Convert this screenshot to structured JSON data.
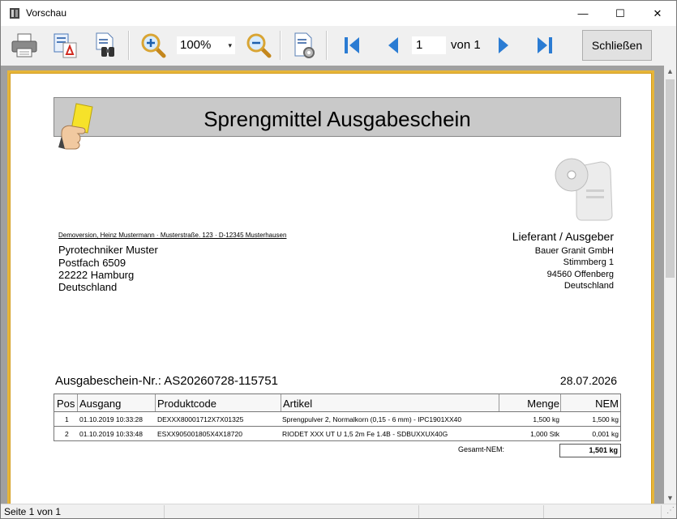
{
  "window": {
    "title": "Vorschau",
    "minimize_glyph": "—",
    "maximize_glyph": "☐",
    "close_glyph": "✕"
  },
  "toolbar": {
    "zoom_value": "100%",
    "page_value": "1",
    "page_of": "von 1",
    "close_label": "Schließen"
  },
  "document": {
    "title": "Sprengmittel Ausgabeschein",
    "sender_line": "Demoversion, Heinz Mustermann · Musterstraße. 123 · D-12345 Musterhausen",
    "recipient": {
      "line1": "Pyrotechniker Muster",
      "line2": "Postfach 6509",
      "line3": "22222 Hamburg",
      "line4": "Deutschland"
    },
    "supplier": {
      "heading": "Lieferant / Ausgeber",
      "line1": "Bauer Granit GmbH",
      "line2": "Stimmberg 1",
      "line3": "94560 Offenberg",
      "line4": "Deutschland"
    },
    "doc_number": "Ausgabeschein-Nr.: AS20260728-115751",
    "doc_date": "28.07.2026",
    "table": {
      "headers": [
        "Pos",
        "Ausgang",
        "Produktcode",
        "Artikel",
        "Menge",
        "NEM"
      ],
      "rows": [
        [
          "1",
          "01.10.2019 10:33:28",
          "DEXXX80001712X7X01325",
          "Sprengpulver 2, Normalkorn (0,15 - 6 mm) - IPC1901XX40",
          "1,500 kg",
          "1,500 kg"
        ],
        [
          "2",
          "01.10.2019 10:33:48",
          "ESXX905001805X4X18720",
          "RIODET XXX UT U 1,5 2m Fe 1.4B - SDBUXXUX40G",
          "1,000 Stk",
          "0,001 kg"
        ]
      ]
    },
    "total_label": "Gesamt-NEM:",
    "total_value": "1,501 kg"
  },
  "status": {
    "page_info": "Seite 1 von 1"
  },
  "colors": {
    "page_border": "#e6b53a",
    "viewport_bg": "#a0a0a0",
    "header_bg": "#c9c9c9",
    "nav_blue": "#2b7cd3"
  }
}
